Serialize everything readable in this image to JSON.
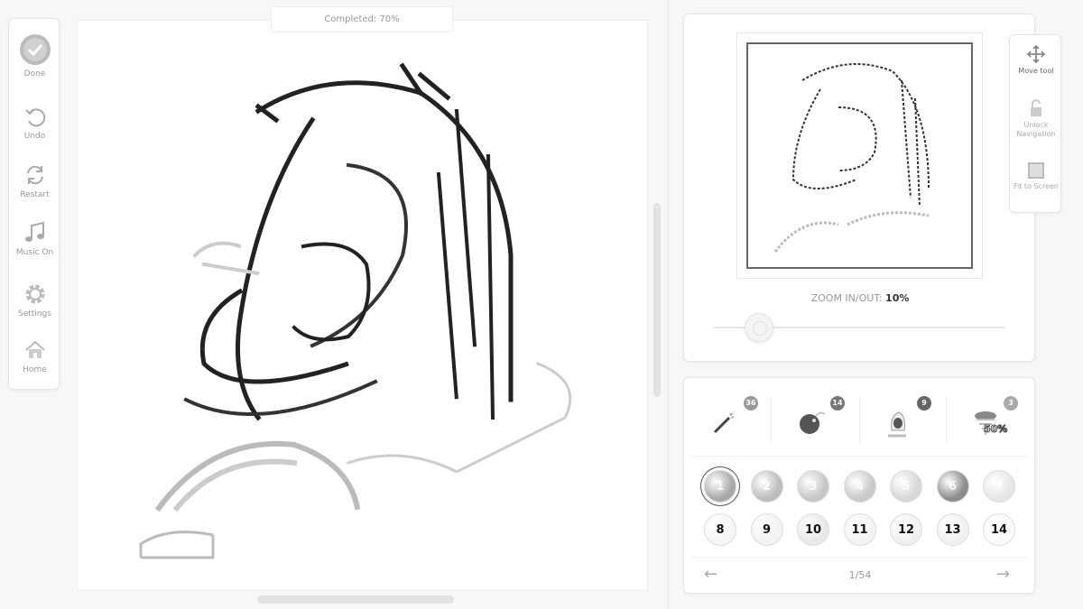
{
  "sidebar": {
    "items": [
      {
        "label": "Done",
        "icon": "check-circle-icon"
      },
      {
        "label": "Undo",
        "icon": "undo-icon"
      },
      {
        "label": "Restart",
        "icon": "restart-icon"
      },
      {
        "label": "Music On",
        "icon": "music-icon"
      },
      {
        "label": "Settings",
        "icon": "gear-icon"
      },
      {
        "label": "Home",
        "icon": "home-icon"
      }
    ]
  },
  "canvas": {
    "completed": "Completed: 70%",
    "progress": 70
  },
  "preview": {
    "zoom_label": "ZOOM IN/OUT:",
    "zoom_value": "10%"
  },
  "tools": [
    {
      "label": "Move tool",
      "icon": "move-icon"
    },
    {
      "label": "Unlock Navigation",
      "icon": "lock-icon"
    },
    {
      "label": "Fit to Screen",
      "icon": "fit-screen-icon"
    }
  ],
  "boosters": [
    {
      "name": "magic-wand",
      "count": "36"
    },
    {
      "name": "bomb",
      "count": "14"
    },
    {
      "name": "paint-bucket",
      "count": "9"
    },
    {
      "name": "tornado",
      "count": "3",
      "label": "50%"
    }
  ],
  "palette": {
    "colors": [
      {
        "n": "1",
        "color": "#a8a8a8",
        "selected": true
      },
      {
        "n": "2",
        "color": "#bdbdbd"
      },
      {
        "n": "3",
        "color": "#c6c6c6"
      },
      {
        "n": "4",
        "color": "#cacaca"
      },
      {
        "n": "5",
        "color": "#d8d8d8"
      },
      {
        "n": "6",
        "color": "#8c8c8c"
      },
      {
        "n": "7",
        "color": "#e6e6e6"
      },
      {
        "n": "8",
        "color": "#f6f6f6"
      },
      {
        "n": "9",
        "color": "#f2f2f2"
      },
      {
        "n": "10",
        "color": "#e8e8e8"
      },
      {
        "n": "11",
        "color": "#f3f3f3"
      },
      {
        "n": "12",
        "color": "#f0f0f0"
      },
      {
        "n": "13",
        "color": "#f0f0f0"
      },
      {
        "n": "14",
        "color": "#fafafa"
      }
    ],
    "page": "1/54",
    "prev": "←",
    "next": "→"
  }
}
